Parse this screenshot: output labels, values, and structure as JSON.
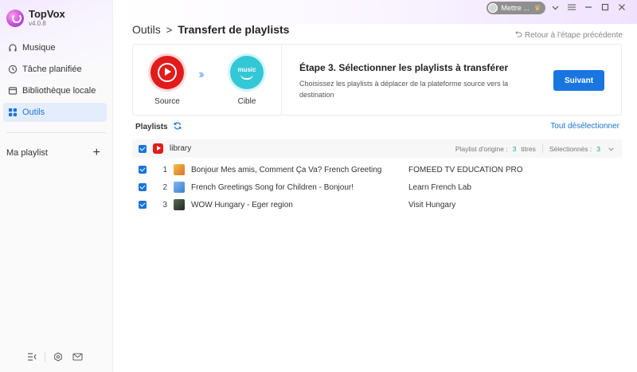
{
  "app": {
    "name": "TopVox",
    "version": "v4.0.8"
  },
  "sidebar": {
    "items": [
      {
        "label": "Musique",
        "icon": "headphones-icon"
      },
      {
        "label": "Tâche planifiée",
        "icon": "clock-icon"
      },
      {
        "label": "Bibliothèque locale",
        "icon": "library-icon"
      },
      {
        "label": "Outils",
        "icon": "grid-icon",
        "active": true
      }
    ],
    "my_playlist_label": "Ma playlist",
    "add_symbol": "+"
  },
  "titlebar": {
    "user_label": "Mettre ...",
    "crown_icon": "crown-icon"
  },
  "breadcrumb": {
    "root": "Outils",
    "separator": ">",
    "current": "Transfert de playlists"
  },
  "back_link": "Retour à l'étape précédente",
  "step": {
    "source_label": "Source",
    "target_label": "Cible",
    "target_logo_text": "music",
    "title": "Étape 3. Sélectionner les playlists à transférer",
    "description": "Choisissez les playlists à déplacer de la plateforme source vers la destination",
    "next_button": "Suivant"
  },
  "playlists": {
    "header": "Playlists",
    "deselect_all": "Tout désélectionner",
    "group": {
      "name": "library",
      "origin_label": "Playlist d'origine :",
      "origin_count": "3",
      "origin_unit": "titres",
      "selected_label": "Sélectionnés :",
      "selected_count": "3"
    },
    "tracks": [
      {
        "index": "1",
        "title": "Bonjour Mes amis, Comment Ça Va? French Greeting",
        "artist": "FOMEED TV EDUCATION PRO",
        "thumb_color": "#e8a13a"
      },
      {
        "index": "2",
        "title": "French Greetings Song for Children - Bonjour!",
        "artist": "Learn French Lab",
        "thumb_color": "#5fa0e8"
      },
      {
        "index": "3",
        "title": "WOW Hungary - Eger region",
        "artist": "Visit Hungary",
        "thumb_color": "#3a4a3a"
      }
    ]
  },
  "colors": {
    "accent": "#1a73d9",
    "button": "#1976e0",
    "youtube_red": "#e21b1b",
    "amazon_teal": "#34c7d6",
    "count_green": "#1aa39a"
  }
}
